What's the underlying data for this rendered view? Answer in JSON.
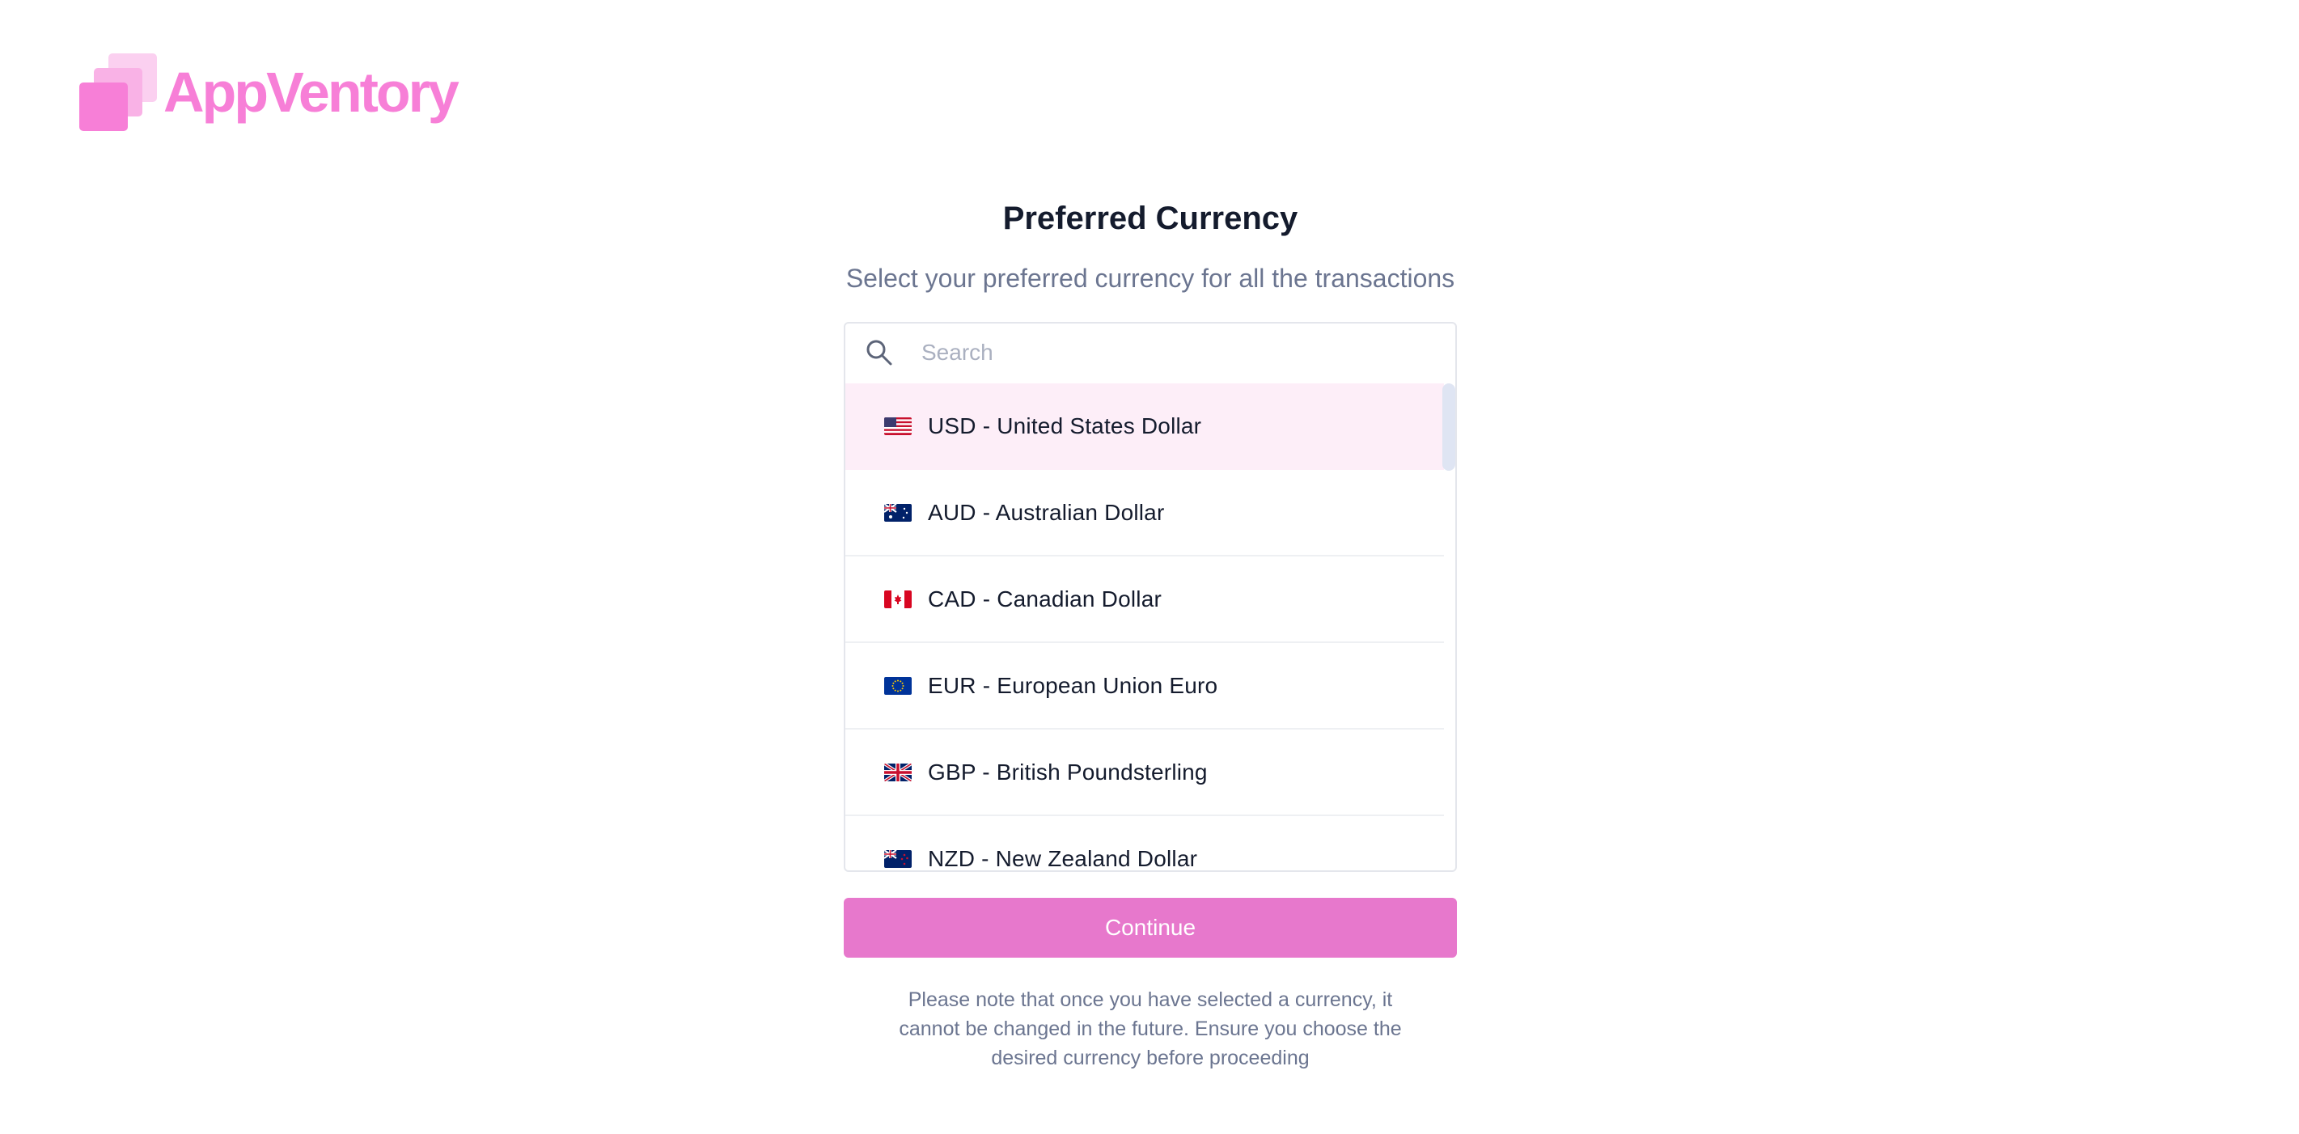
{
  "brand": {
    "name": "AppVentory",
    "color": "#f77fd7"
  },
  "page": {
    "title": "Preferred Currency",
    "subtitle": "Select your preferred currency for all the transactions"
  },
  "search": {
    "placeholder": "Search",
    "value": "",
    "icon": "search-icon"
  },
  "currencies": [
    {
      "label": "USD - United States Dollar",
      "flag": "us-flag-icon",
      "selected": true
    },
    {
      "label": "AUD - Australian Dollar",
      "flag": "au-flag-icon",
      "selected": false
    },
    {
      "label": "CAD - Canadian Dollar",
      "flag": "ca-flag-icon",
      "selected": false
    },
    {
      "label": "EUR - European Union Euro",
      "flag": "eu-flag-icon",
      "selected": false
    },
    {
      "label": "GBP - British Poundsterling",
      "flag": "gb-flag-icon",
      "selected": false
    },
    {
      "label": "NZD - New Zealand Dollar",
      "flag": "nz-flag-icon",
      "selected": false
    }
  ],
  "continue_label": "Continue",
  "note": "Please note that once you have selected a currency, it cannot be changed in the future. Ensure you choose the desired currency before proceeding",
  "colors": {
    "accent": "#e778cc",
    "selected_row": "#fdeef8",
    "title": "#141b2d",
    "muted": "#6b7590"
  }
}
